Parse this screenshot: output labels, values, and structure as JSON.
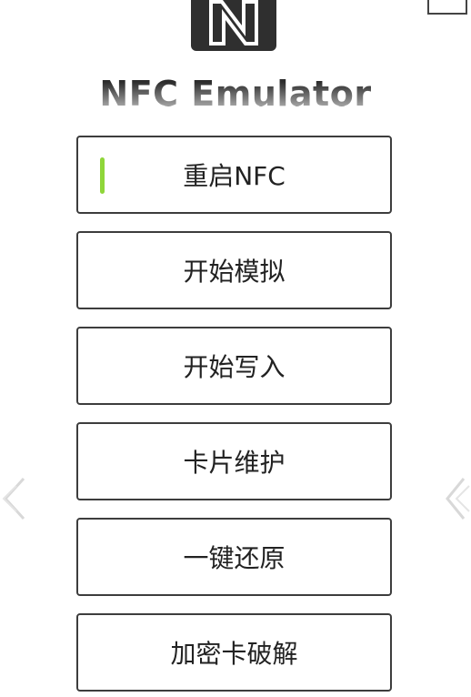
{
  "app": {
    "title": "NFC Emulator"
  },
  "menu": {
    "items": [
      {
        "label": "重启NFC",
        "active": true
      },
      {
        "label": "开始模拟",
        "active": false
      },
      {
        "label": "开始写入",
        "active": false
      },
      {
        "label": "卡片维护",
        "active": false
      },
      {
        "label": "一键还原",
        "active": false
      },
      {
        "label": "加密卡破解",
        "active": false
      }
    ]
  },
  "icons": {
    "logo": "nfc-logo-icon",
    "left_nav": "chevron-left-icon",
    "right_nav": "chevron-right-icon"
  },
  "colors": {
    "active_indicator": "#8fd63a",
    "border": "#3d3d3d",
    "logo_bg": "#2f2f2f"
  }
}
